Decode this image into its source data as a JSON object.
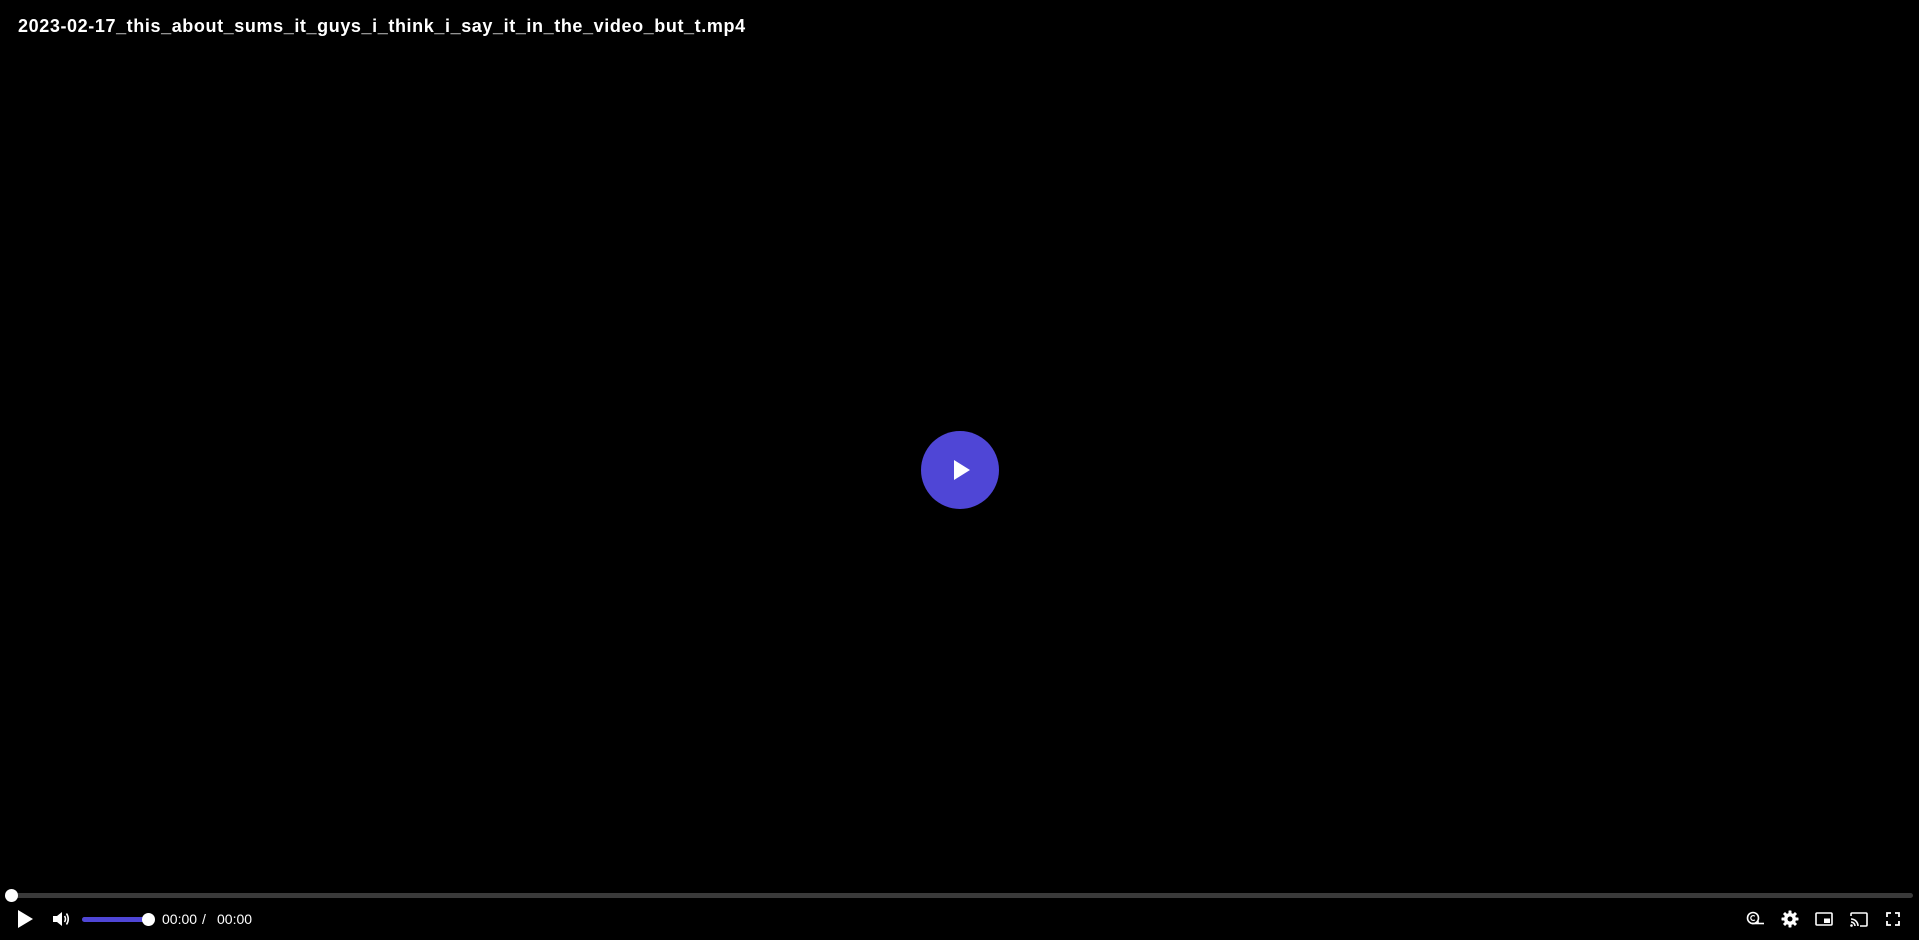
{
  "video": {
    "title": "2023-02-17_this_about_sums_it_guys_i_think_i_say_it_in_the_video_but_t.mp4",
    "current_time": "00:00",
    "separator": "/",
    "duration": "00:00",
    "progress_fraction": 0,
    "volume_fraction": 1
  },
  "colors": {
    "accent": "#4f46d6",
    "background": "#000000",
    "track": "#3a3a3a"
  },
  "icons": {
    "big_play": "play-icon",
    "play": "play-icon",
    "volume": "volume-icon",
    "captions": "captions-icon",
    "settings": "gear-icon",
    "pip": "picture-in-picture-icon",
    "cast": "cast-icon",
    "fullscreen": "fullscreen-icon"
  }
}
